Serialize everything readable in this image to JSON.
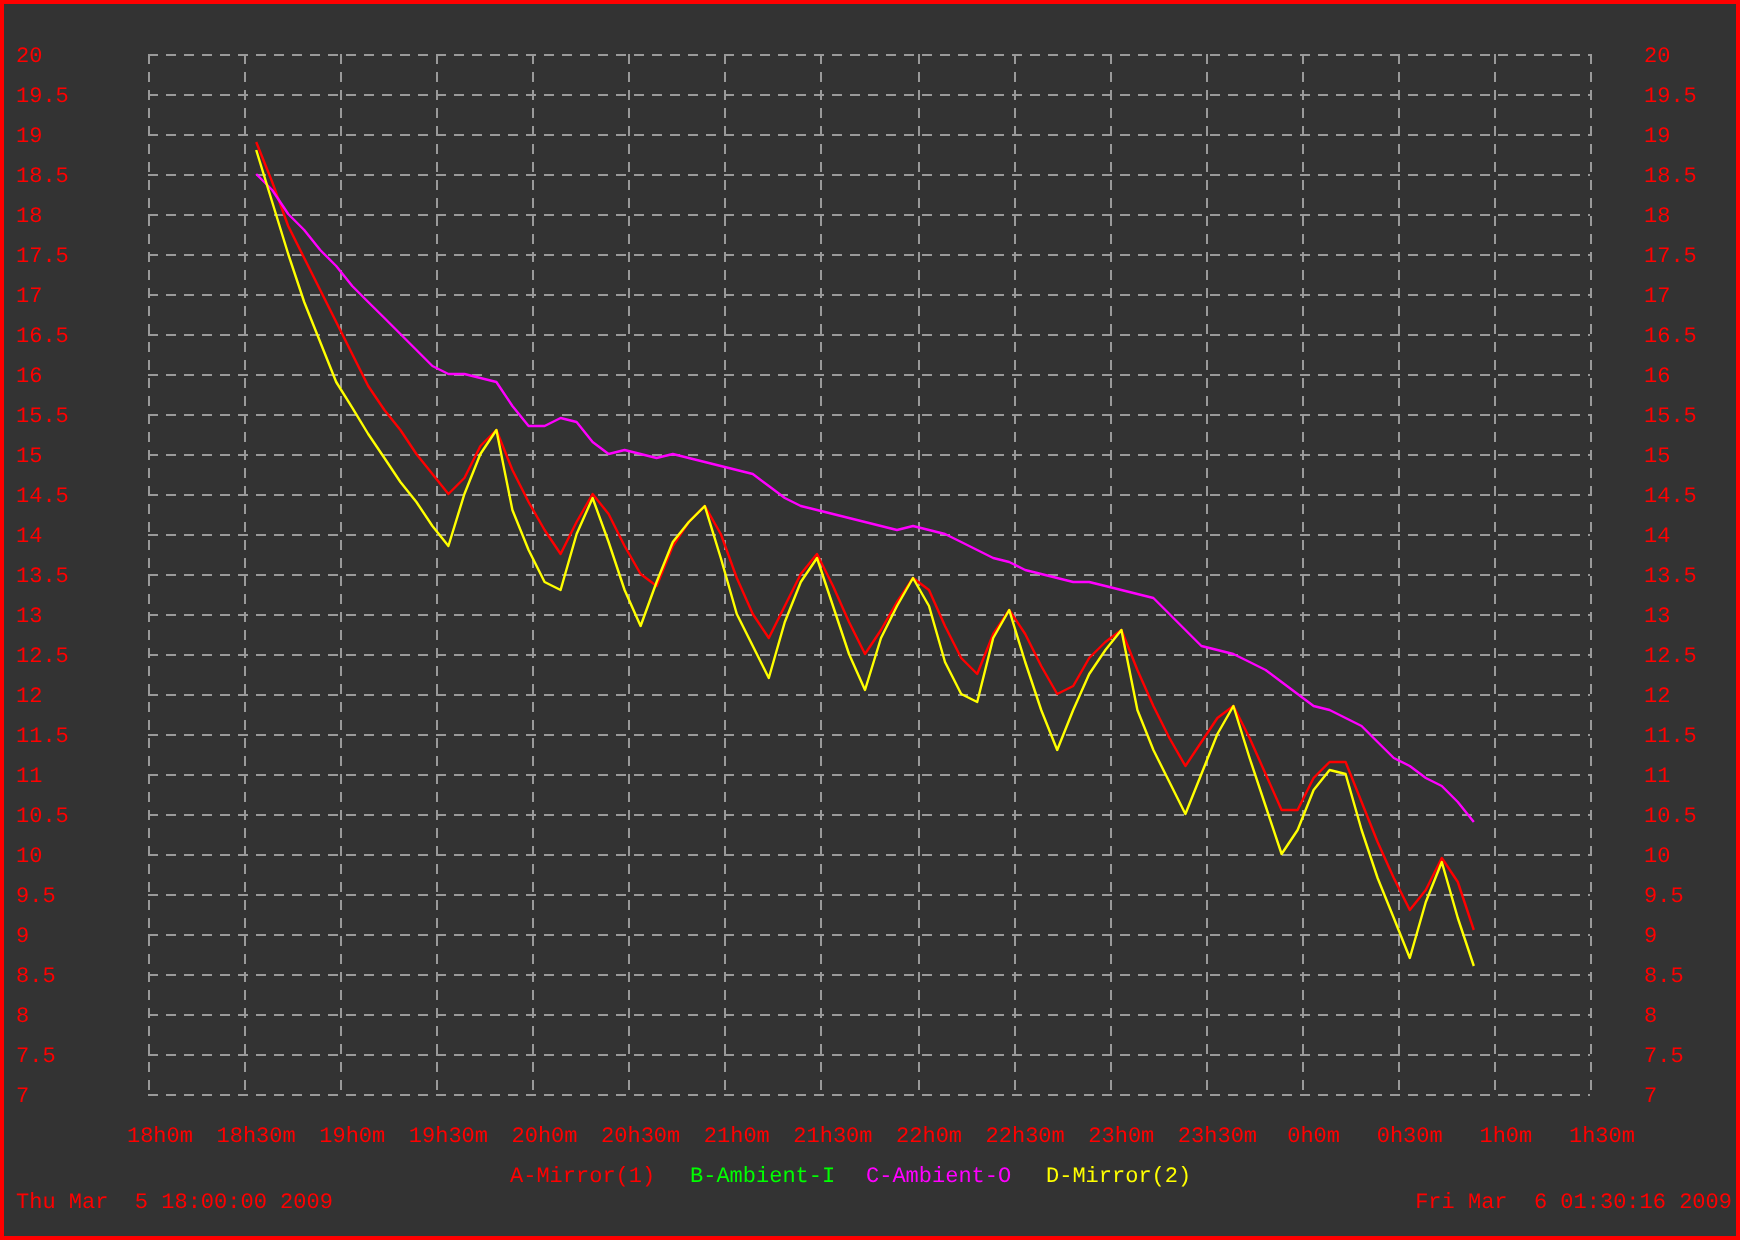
{
  "chart_data": {
    "type": "line",
    "categories": [
      "18h0m",
      null,
      null,
      null,
      null,
      null,
      "18h30m",
      null,
      null,
      null,
      null,
      null,
      "19h0m",
      null,
      null,
      null,
      null,
      null,
      "19h30m",
      null,
      null,
      null,
      null,
      null,
      "20h0m",
      null,
      null,
      null,
      null,
      null,
      "20h30m",
      null,
      null,
      null,
      null,
      null,
      "21h0m",
      null,
      null,
      null,
      null,
      null,
      "21h30m",
      null,
      null,
      null,
      null,
      null,
      "22h0m",
      null,
      null,
      null,
      null,
      null,
      "22h30m",
      null,
      null,
      null,
      null,
      null,
      "23h0m",
      null,
      null,
      null,
      null,
      null,
      "23h30m",
      null,
      null,
      null,
      null,
      null,
      "0h0m",
      null,
      null,
      null,
      null,
      null,
      "0h30m",
      null,
      null,
      null,
      null,
      null,
      "1h0m",
      null,
      null,
      null,
      null,
      null,
      "1h30m"
    ],
    "ylim": [
      7,
      20
    ],
    "grid": true,
    "yticks": [
      {
        "value": 7,
        "label": "7"
      },
      {
        "value": 7.5,
        "label": "7.5"
      },
      {
        "value": 8,
        "label": "8"
      },
      {
        "value": 8.5,
        "label": "8.5"
      },
      {
        "value": 9,
        "label": "9"
      },
      {
        "value": 9.5,
        "label": "9.5"
      },
      {
        "value": 10,
        "label": "10"
      },
      {
        "value": 10.5,
        "label": "10.5"
      },
      {
        "value": 11,
        "label": "11"
      },
      {
        "value": 11.5,
        "label": "11.5"
      },
      {
        "value": 12,
        "label": "12"
      },
      {
        "value": 12.5,
        "label": "12.5"
      },
      {
        "value": 13,
        "label": "13"
      },
      {
        "value": 13.5,
        "label": "13.5"
      },
      {
        "value": 14,
        "label": "14"
      },
      {
        "value": 14.5,
        "label": "14.5"
      },
      {
        "value": 15,
        "label": "15"
      },
      {
        "value": 15.5,
        "label": "15.5"
      },
      {
        "value": 16,
        "label": "16"
      },
      {
        "value": 16.5,
        "label": "16.5"
      },
      {
        "value": 17,
        "label": "17"
      },
      {
        "value": 17.5,
        "label": "17.5"
      },
      {
        "value": 18,
        "label": "18"
      },
      {
        "value": 18.5,
        "label": "18.5"
      },
      {
        "value": 19,
        "label": "19"
      },
      {
        "value": 19.5,
        "label": "19.5"
      },
      {
        "value": 20,
        "label": "20"
      }
    ],
    "series": [
      {
        "name": "A-Mirror(1)",
        "color": "#ff0000",
        "values": [
          null,
          null,
          null,
          null,
          null,
          null,
          18.9,
          18.4,
          17.85,
          17.45,
          17.05,
          16.65,
          16.25,
          15.85,
          15.55,
          15.3,
          15.0,
          14.75,
          14.5,
          14.7,
          15.1,
          15.3,
          14.8,
          14.4,
          14.05,
          13.75,
          14.15,
          14.5,
          14.25,
          13.85,
          13.5,
          13.35,
          13.85,
          14.15,
          14.35,
          14.0,
          13.45,
          13.0,
          12.7,
          13.1,
          13.5,
          13.75,
          13.35,
          12.9,
          12.5,
          12.8,
          13.15,
          13.45,
          13.3,
          12.85,
          12.45,
          12.25,
          12.75,
          13.05,
          12.75,
          12.35,
          12.0,
          12.1,
          12.45,
          12.65,
          12.8,
          12.3,
          11.85,
          11.45,
          11.1,
          11.4,
          11.7,
          11.85,
          11.45,
          11.0,
          10.55,
          10.55,
          10.95,
          11.15,
          11.15,
          10.65,
          10.15,
          9.7,
          9.3,
          9.55,
          9.95,
          9.65,
          9.05,
          null,
          null,
          null,
          null,
          null,
          null,
          null,
          null
        ]
      },
      {
        "name": "B-Ambient-I",
        "color": "#00ff00",
        "values": [
          null,
          null,
          null,
          null,
          null,
          null,
          null,
          null,
          null,
          null,
          null,
          null,
          null,
          null,
          null,
          null,
          null,
          null,
          null,
          null,
          null,
          null,
          null,
          null,
          null,
          null,
          null,
          null,
          null,
          null,
          null,
          null,
          null,
          null,
          null,
          null,
          null,
          null,
          null,
          null,
          null,
          null,
          null,
          null,
          null,
          null,
          null,
          null,
          null,
          null,
          null,
          null,
          null,
          null,
          null,
          null,
          null,
          null,
          null,
          null,
          null,
          null,
          null,
          null,
          null,
          null,
          null,
          null,
          null,
          null,
          null,
          null,
          null,
          null,
          null,
          null,
          null,
          null,
          null,
          null,
          null,
          null,
          null,
          null,
          null,
          null,
          null,
          null,
          null,
          null,
          null
        ]
      },
      {
        "name": "C-Ambient-O",
        "color": "#ff00ff",
        "values": [
          null,
          null,
          null,
          null,
          null,
          null,
          18.5,
          18.3,
          18.0,
          17.8,
          17.55,
          17.35,
          17.1,
          16.9,
          16.7,
          16.5,
          16.3,
          16.1,
          16.0,
          16.0,
          15.95,
          15.9,
          15.6,
          15.35,
          15.35,
          15.45,
          15.4,
          15.15,
          15.0,
          15.05,
          15.0,
          14.95,
          15.0,
          14.95,
          14.9,
          14.85,
          14.8,
          14.75,
          14.6,
          14.45,
          14.35,
          14.3,
          14.25,
          14.2,
          14.15,
          14.1,
          14.05,
          14.1,
          14.05,
          14.0,
          13.9,
          13.8,
          13.7,
          13.65,
          13.55,
          13.5,
          13.45,
          13.4,
          13.4,
          13.35,
          13.3,
          13.25,
          13.2,
          13.0,
          12.8,
          12.6,
          12.55,
          12.5,
          12.4,
          12.3,
          12.15,
          12.0,
          11.85,
          11.8,
          11.7,
          11.6,
          11.4,
          11.2,
          11.1,
          10.95,
          10.85,
          10.65,
          10.4,
          null,
          null,
          null,
          null,
          null,
          null,
          null,
          null
        ]
      },
      {
        "name": "D-Mirror(2)",
        "color": "#ffff00",
        "values": [
          null,
          null,
          null,
          null,
          null,
          null,
          18.8,
          18.15,
          17.5,
          16.9,
          16.4,
          15.9,
          15.58,
          15.25,
          14.95,
          14.65,
          14.4,
          14.1,
          13.85,
          14.5,
          15.0,
          15.3,
          14.3,
          13.8,
          13.4,
          13.3,
          14.0,
          14.45,
          13.9,
          13.3,
          12.85,
          13.4,
          13.9,
          14.15,
          14.35,
          13.7,
          13.0,
          12.6,
          12.2,
          12.9,
          13.4,
          13.7,
          13.1,
          12.5,
          12.05,
          12.7,
          13.1,
          13.45,
          13.1,
          12.4,
          12.0,
          11.9,
          12.7,
          13.05,
          12.4,
          11.8,
          11.3,
          11.8,
          12.25,
          12.55,
          12.8,
          11.8,
          11.3,
          10.9,
          10.5,
          11.0,
          11.5,
          11.85,
          11.2,
          10.6,
          10.0,
          10.3,
          10.8,
          11.05,
          11.0,
          10.3,
          9.7,
          9.2,
          8.7,
          9.4,
          9.9,
          9.2,
          8.6,
          null,
          null,
          null,
          null,
          null,
          null,
          null,
          null
        ]
      }
    ]
  },
  "right_axis": {
    "labels": [
      "20",
      "19.5",
      "19",
      "18.5",
      "18",
      "17.5",
      "17",
      "16.5",
      "16",
      "15.5",
      "15",
      "14.5",
      "14",
      "13.5",
      "13",
      "12.5",
      "12",
      "11.5",
      "11",
      "10.5",
      "10",
      "9.5",
      "9",
      "8.5",
      "8",
      "7.5",
      "7"
    ]
  },
  "footer": {
    "start": "Thu Mar  5 18:00:00 2009",
    "end": "Fri Mar  6 01:30:16 2009"
  }
}
